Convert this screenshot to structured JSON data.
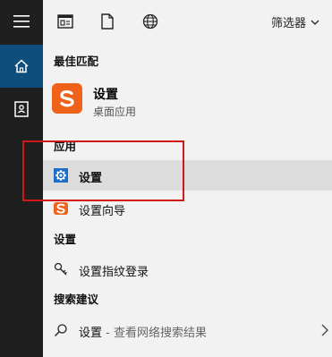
{
  "toolbar": {
    "filter_label": "筛选器"
  },
  "sections": {
    "best_match": "最佳匹配",
    "apps": "应用",
    "settings": "设置",
    "search_suggestions": "搜索建议"
  },
  "best_match": {
    "title": "设置",
    "subtitle": "桌面应用"
  },
  "apps": [
    {
      "label": "设置"
    },
    {
      "label": "设置向导"
    }
  ],
  "settings_items": [
    {
      "label": "设置指纹登录"
    }
  ],
  "suggestions": [
    {
      "label": "设置",
      "detail": " - 查看网络搜索结果"
    }
  ],
  "colors": {
    "accent": "#0f4d7c",
    "app_icon": "#ee6219",
    "settings_icon": "#1f6fc6",
    "annotation": "#d01818"
  }
}
